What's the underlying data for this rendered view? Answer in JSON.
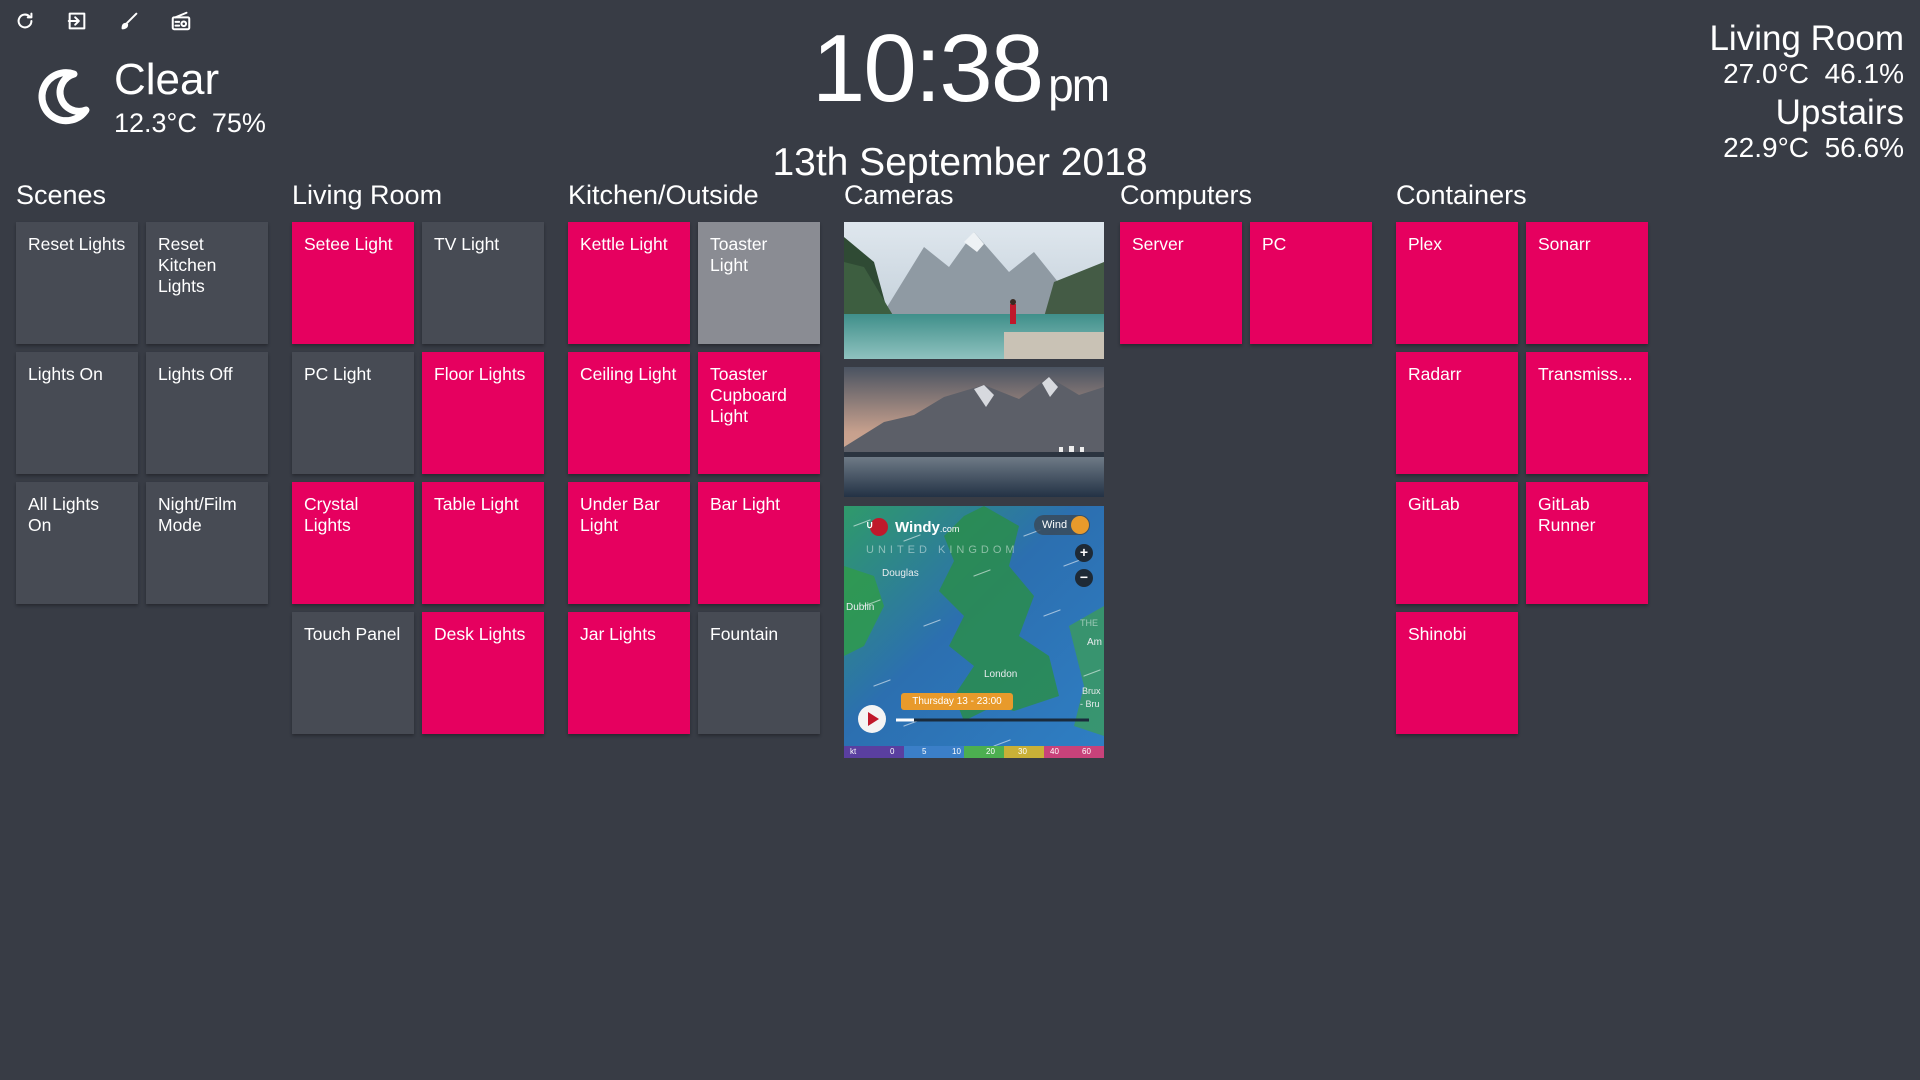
{
  "toolbar": {
    "icons": [
      "refresh-icon",
      "exit-icon",
      "brush-icon",
      "radio-icon"
    ]
  },
  "weather": {
    "icon": "moon-icon",
    "condition": "Clear",
    "temperature": "12.3°C",
    "humidity": "75%"
  },
  "clock": {
    "time": "10:38",
    "ampm": "pm",
    "date": "13th September 2018"
  },
  "sensors": [
    {
      "name": "Living Room",
      "temperature": "27.0°C",
      "humidity": "46.1%"
    },
    {
      "name": "Upstairs",
      "temperature": "22.9°C",
      "humidity": "56.6%"
    }
  ],
  "groups": {
    "scenes": {
      "title": "Scenes",
      "tiles": [
        {
          "label": "Reset Lights",
          "state": "off"
        },
        {
          "label": "Reset Kitchen Lights",
          "state": "off"
        },
        {
          "label": "Lights On",
          "state": "off"
        },
        {
          "label": "Lights Off",
          "state": "off"
        },
        {
          "label": "All Lights On",
          "state": "off"
        },
        {
          "label": "Night/Film Mode",
          "state": "off"
        }
      ]
    },
    "living_room": {
      "title": "Living Room",
      "tiles": [
        {
          "label": "Setee Light",
          "state": "on"
        },
        {
          "label": "TV Light",
          "state": "off"
        },
        {
          "label": "PC Light",
          "state": "off"
        },
        {
          "label": "Floor Lights",
          "state": "on"
        },
        {
          "label": "Crystal Lights",
          "state": "on"
        },
        {
          "label": "Table Light",
          "state": "on"
        },
        {
          "label": "Touch Panel",
          "state": "off"
        },
        {
          "label": "Desk Lights",
          "state": "on"
        }
      ]
    },
    "kitchen": {
      "title": "Kitchen/Outside",
      "tiles": [
        {
          "label": "Kettle Light",
          "state": "on"
        },
        {
          "label": "Toaster Light",
          "state": "dim"
        },
        {
          "label": "Ceiling Light",
          "state": "on"
        },
        {
          "label": "Toaster Cupboard Light",
          "state": "on"
        },
        {
          "label": "Under Bar Light",
          "state": "on"
        },
        {
          "label": "Bar Light",
          "state": "on"
        },
        {
          "label": "Jar Lights",
          "state": "on"
        },
        {
          "label": "Fountain",
          "state": "off"
        }
      ]
    },
    "cameras": {
      "title": "Cameras",
      "windy": {
        "brand": "Windy",
        "brand_suffix": ".com",
        "layer": "Wind",
        "timestamp": "Thursday 13 - 23:00",
        "places": [
          "UNITED KINGDOM",
          "Douglas",
          "Dublin",
          "London",
          "THE",
          "Am",
          "Brux",
          "- Bru"
        ],
        "scale_unit": "kt",
        "scale": [
          "0",
          "5",
          "10",
          "20",
          "30",
          "40",
          "60"
        ]
      }
    },
    "computers": {
      "title": "Computers",
      "tiles": [
        {
          "label": "Server",
          "state": "on"
        },
        {
          "label": "PC",
          "state": "on"
        }
      ]
    },
    "containers": {
      "title": "Containers",
      "tiles": [
        {
          "label": "Plex",
          "state": "on"
        },
        {
          "label": "Sonarr",
          "state": "on"
        },
        {
          "label": "Radarr",
          "state": "on"
        },
        {
          "label": "Transmiss...",
          "state": "on"
        },
        {
          "label": "GitLab",
          "state": "on"
        },
        {
          "label": "GitLab Runner",
          "state": "on"
        },
        {
          "label": "Shinobi",
          "state": "on"
        }
      ]
    }
  },
  "colors": {
    "background": "#383c45",
    "tile_on": "#e6005f",
    "tile_off": "#474b54",
    "tile_dim": "#8a8c93"
  }
}
